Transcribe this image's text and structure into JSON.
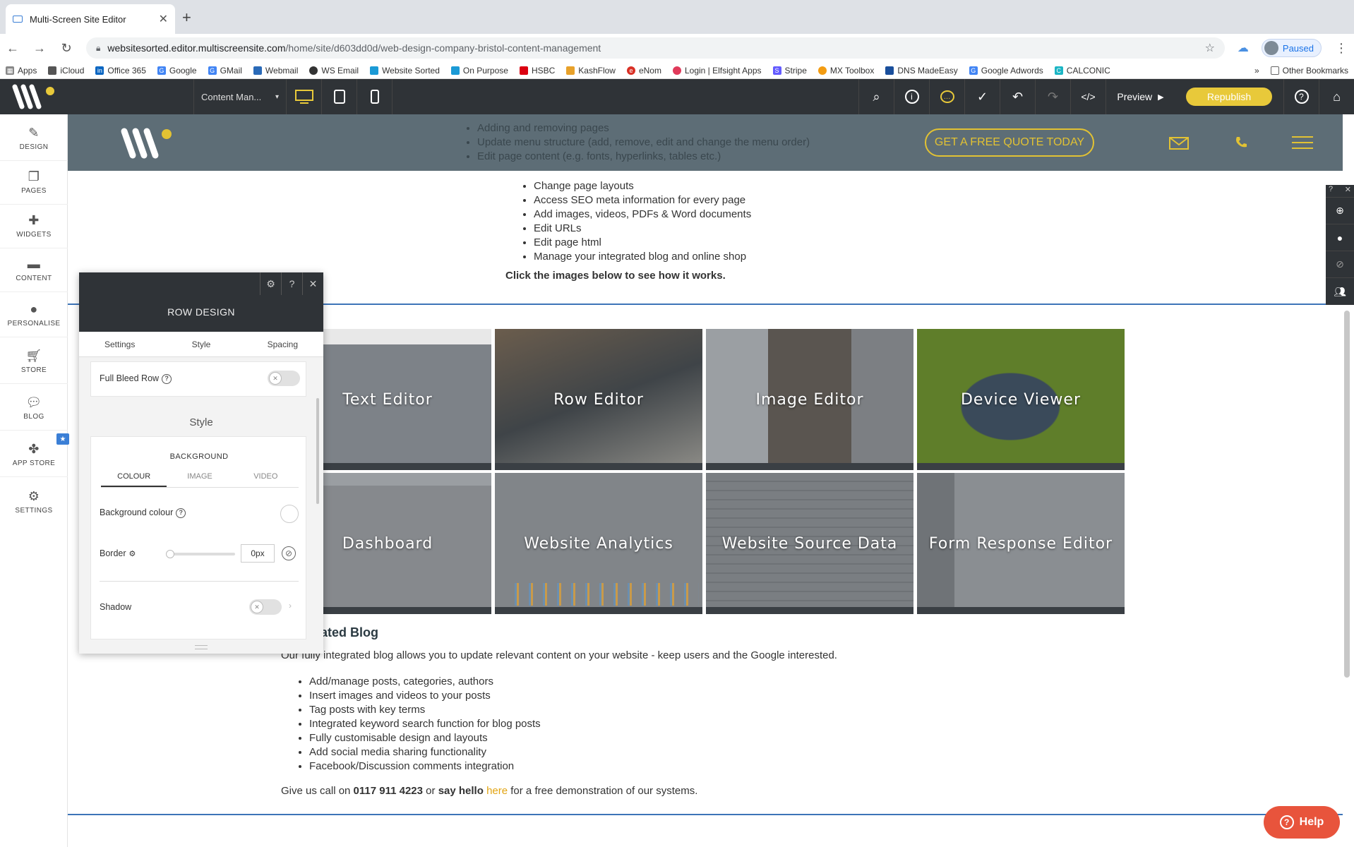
{
  "browser": {
    "tab_title": "Multi-Screen Site Editor",
    "url_host": "websitesorted.editor.multiscreensite.com",
    "url_path": "/home/site/d603dd0d/web-design-company-bristol-content-management",
    "profile_label": "Paused",
    "bookmarks": [
      "Apps",
      "iCloud",
      "Office 365",
      "Google",
      "GMail",
      "Webmail",
      "WS Email",
      "Website Sorted",
      "On Purpose",
      "HSBC",
      "KashFlow",
      "eNom",
      "Login | Elfsight Apps",
      "Stripe",
      "MX Toolbox",
      "DNS MadeEasy",
      "Google Adwords",
      "CALCONIC"
    ],
    "bookmarks_more": "»",
    "other_bookmarks": "Other Bookmarks"
  },
  "editor": {
    "page_selector": "Content Man...",
    "preview_label": "Preview",
    "republish_label": "Republish",
    "accent": "#e8c93a"
  },
  "sidebar": {
    "items": [
      "DESIGN",
      "PAGES",
      "WIDGETS",
      "CONTENT",
      "PERSONALISE",
      "STORE",
      "BLOG",
      "APP STORE",
      "SETTINGS"
    ]
  },
  "site": {
    "header_list": [
      "Adding and removing pages",
      "Update menu structure (add, remove, edit and change the menu order)",
      "Edit page content (e.g. fonts, hyperlinks, tables etc.)"
    ],
    "quote_button": "GET A FREE QUOTE TODAY",
    "cms_list": [
      "Change page layouts",
      "Access SEO meta information for every page",
      "Add images, videos, PDFs & Word documents",
      "Edit URLs",
      "Edit page html",
      "Manage your integrated blog and online shop"
    ],
    "click_line": "Click the images below to see how it works.",
    "tiles": [
      "Text Editor",
      "Row Editor",
      "Image Editor",
      "Device Viewer",
      "Dashboard",
      "Website Analytics",
      "Website Source Data",
      "Form Response Editor"
    ],
    "blog_title": "ated Blog",
    "blog_intro": "Our fully integrated blog allows you to update relevant content on your website - keep users and the Google interested.",
    "blog_list": [
      "Add/manage posts, categories, authors",
      "Insert images and videos to your posts",
      "Tag posts with key terms",
      "Integrated keyword search function for blog posts",
      "Fully customisable design and layouts",
      "Add social media sharing functionality",
      "Facebook/Discussion comments integration"
    ],
    "call_prefix": "Give us call on ",
    "call_number": "0117 911 4223",
    "call_or": " or ",
    "call_hello": "say hello",
    "call_space": " ",
    "call_link": "here",
    "call_suffix": " for a free demonstration of our systems."
  },
  "panel": {
    "title": "ROW DESIGN",
    "tabs": [
      "Settings",
      "Style",
      "Spacing"
    ],
    "full_bleed_label": "Full Bleed Row",
    "style_heading": "Style",
    "background_heading": "BACKGROUND",
    "bg_tabs": [
      "COLOUR",
      "IMAGE",
      "VIDEO"
    ],
    "bg_colour_label": "Background colour",
    "border_label": "Border",
    "border_value": "0px",
    "shadow_label": "Shadow"
  },
  "help_label": "Help"
}
